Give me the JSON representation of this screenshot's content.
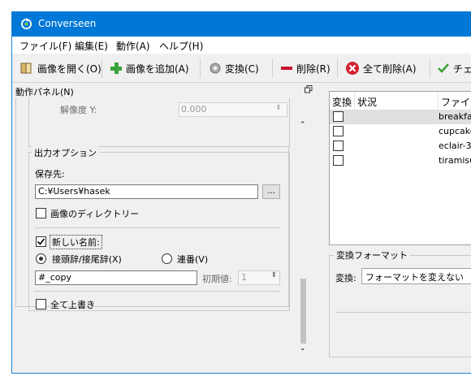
{
  "window": {
    "title": "Converseen"
  },
  "menu": [
    {
      "label": "ファイル(F)"
    },
    {
      "label": "編集(E)"
    },
    {
      "label": "動作(A)"
    },
    {
      "label": "ヘルプ(H)"
    }
  ],
  "toolbar": {
    "open_label": "画像を開く(O)",
    "add_label": "画像を追加(A)",
    "convert_label": "変換(C)",
    "delete_label": "削除(R)",
    "delete_all_label": "全て削除(A)",
    "check_label": "チェッ"
  },
  "panel": {
    "title": "動作パネル(N)",
    "resolution": {
      "label": "解像度 Y:",
      "value": "0.000"
    },
    "output": {
      "title": "出力オプション",
      "save_to_label": "保存先:",
      "save_path": "C:¥Users¥hasek",
      "browse_label": "...",
      "image_dir_label": "画像のディレクトリー",
      "new_name_label": "新しい名前:",
      "prefix_suffix_label": "接頭辞/接尾辞(X)",
      "sequence_label": "連番(V)",
      "name_pattern": "#_copy",
      "initial_label": "初期値:",
      "initial_value": "1",
      "overwrite_label": "全て上書き"
    }
  },
  "filelist": {
    "columns": [
      "変換",
      "状況",
      "ファイル名"
    ],
    "rows": [
      {
        "name": "breakfast"
      },
      {
        "name": "cupcakes"
      },
      {
        "name": "eclair-3"
      },
      {
        "name": "tiramisu"
      }
    ]
  },
  "format": {
    "title": "変換フォーマット",
    "label": "変換:",
    "selected": "フォーマットを変えない"
  },
  "colors": {
    "titlebar": "#0078d7",
    "accent": "#0078d7"
  }
}
